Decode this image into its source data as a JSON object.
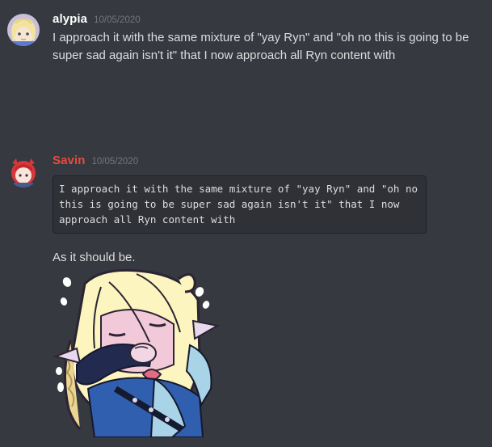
{
  "messages": [
    {
      "username": "alypia",
      "timestamp": "10/05/2020",
      "text": "I approach it with the same mixture of \"yay Ryn\" and \"oh no this is going to be super sad again isn't it\" that I now approach all Ryn content with",
      "avatar_icon": "blonde-character-avatar",
      "name_color": "#ffffff"
    },
    {
      "username": "Savin",
      "timestamp": "10/05/2020",
      "quote_code": "I approach it with the same mixture of \"yay Ryn\" and \"oh no this is going to be super sad again isn't it\" that I now approach all Ryn content with",
      "reply": "As it should be.",
      "avatar_icon": "red-haired-character-avatar",
      "name_color": "#e74c3c",
      "image_icon": "crying-anime-character-sticker"
    }
  ],
  "colors": {
    "background": "#36393f",
    "codeblock_bg": "#2f3136",
    "timestamp": "#72767d",
    "text": "#dcddde"
  }
}
